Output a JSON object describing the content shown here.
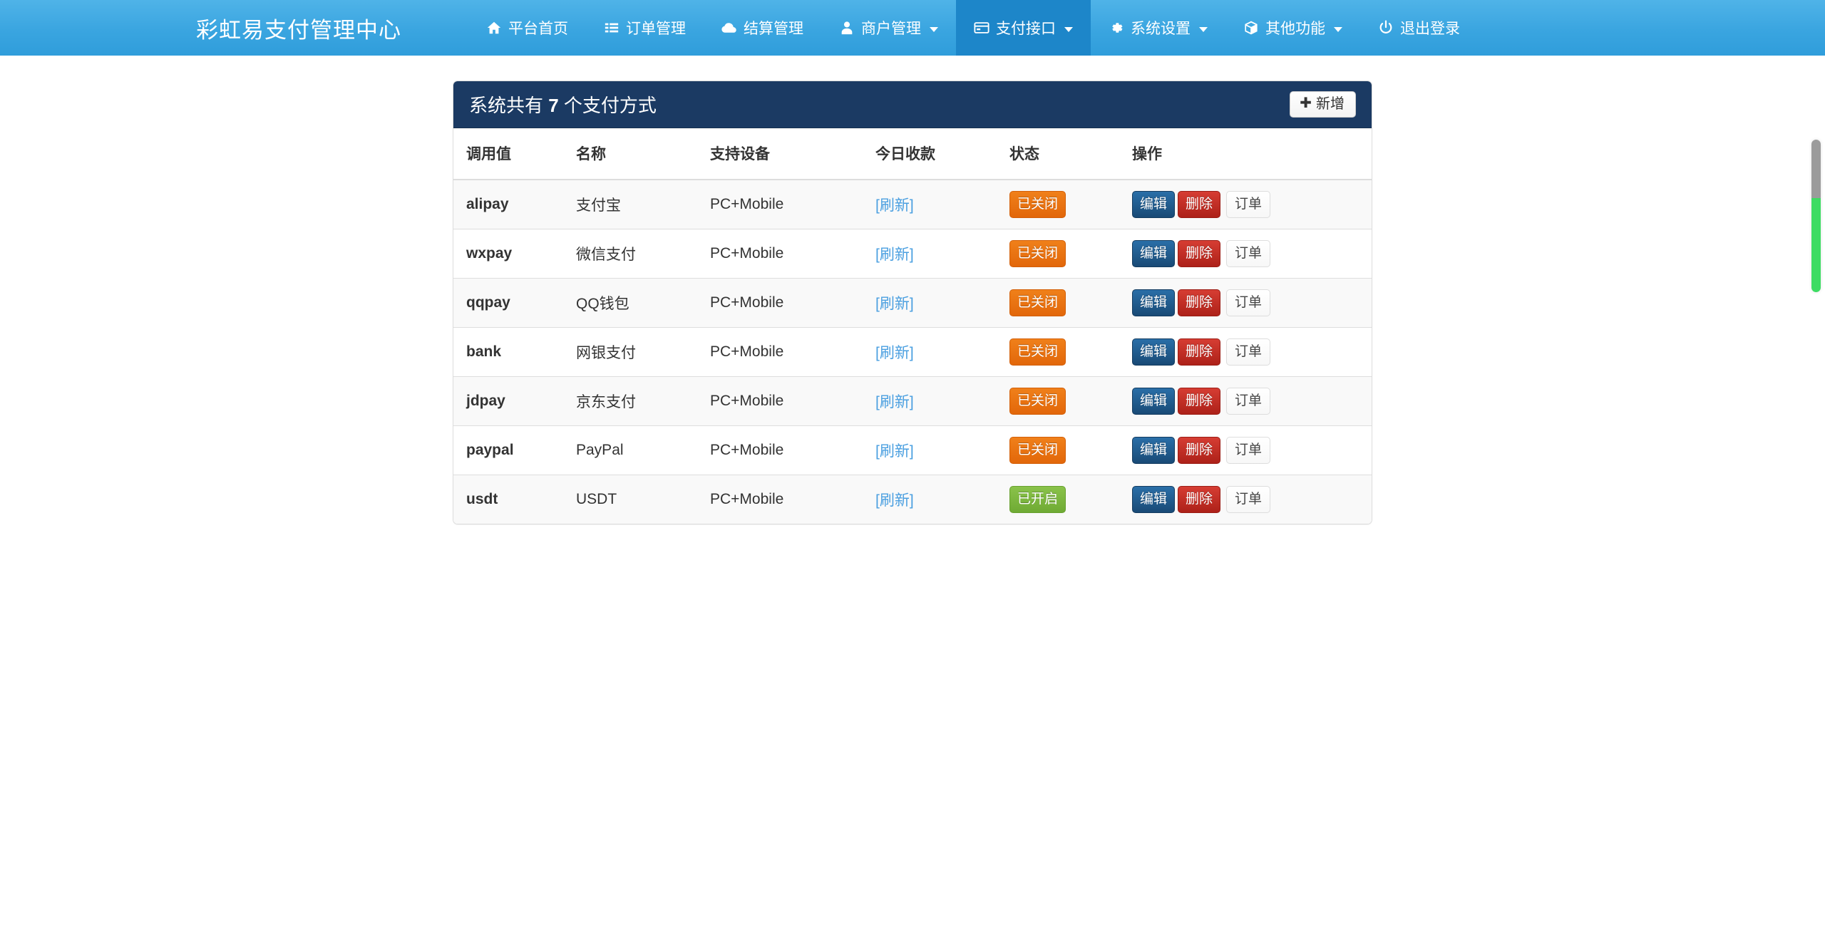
{
  "navbar": {
    "brand": "彩虹易支付管理中心",
    "items": [
      {
        "label": "平台首页",
        "icon": "home-icon",
        "caret": false,
        "active": false
      },
      {
        "label": "订单管理",
        "icon": "list-icon",
        "caret": false,
        "active": false
      },
      {
        "label": "结算管理",
        "icon": "cloud-icon",
        "caret": false,
        "active": false
      },
      {
        "label": "商户管理",
        "icon": "user-icon",
        "caret": true,
        "active": false
      },
      {
        "label": "支付接口",
        "icon": "credit-card-icon",
        "caret": true,
        "active": true
      },
      {
        "label": "系统设置",
        "icon": "gear-icon",
        "caret": true,
        "active": false
      },
      {
        "label": "其他功能",
        "icon": "cube-icon",
        "caret": true,
        "active": false
      },
      {
        "label": "退出登录",
        "icon": "power-icon",
        "caret": false,
        "active": false
      }
    ]
  },
  "panel": {
    "title_prefix": "系统共有 ",
    "title_count": "7",
    "title_suffix": " 个支付方式",
    "title_full": "系统共有 7 个支付方式",
    "add_button": "新增",
    "add_icon": "plus-icon"
  },
  "table": {
    "columns": [
      "调用值",
      "名称",
      "支持设备",
      "今日收款",
      "状态",
      "操作"
    ],
    "refresh_label": "[刷新]",
    "buttons": {
      "edit": "编辑",
      "delete": "删除",
      "order": "订单"
    },
    "rows": [
      {
        "call": "alipay",
        "name": "支付宝",
        "device": "PC+Mobile",
        "today": "[刷新]",
        "status": "已关闭",
        "status_state": "off"
      },
      {
        "call": "wxpay",
        "name": "微信支付",
        "device": "PC+Mobile",
        "today": "[刷新]",
        "status": "已关闭",
        "status_state": "off"
      },
      {
        "call": "qqpay",
        "name": "QQ钱包",
        "device": "PC+Mobile",
        "today": "[刷新]",
        "status": "已关闭",
        "status_state": "off"
      },
      {
        "call": "bank",
        "name": "网银支付",
        "device": "PC+Mobile",
        "today": "[刷新]",
        "status": "已关闭",
        "status_state": "off"
      },
      {
        "call": "jdpay",
        "name": "京东支付",
        "device": "PC+Mobile",
        "today": "[刷新]",
        "status": "已关闭",
        "status_state": "off"
      },
      {
        "call": "paypal",
        "name": "PayPal",
        "device": "PC+Mobile",
        "today": "[刷新]",
        "status": "已关闭",
        "status_state": "off"
      },
      {
        "call": "usdt",
        "name": "USDT",
        "device": "PC+Mobile",
        "today": "[刷新]",
        "status": "已开启",
        "status_state": "on"
      }
    ]
  },
  "colors": {
    "navbar": "#3aa5e0",
    "navbar_active": "#1d86c9",
    "panel_heading": "#1b3a63",
    "status_off": "#e2670a",
    "status_on": "#6faa34",
    "btn_edit": "#194a76",
    "btn_delete": "#ad2119",
    "link": "#4a9fe0",
    "scrollbar_thumb": "#3ddc63"
  }
}
